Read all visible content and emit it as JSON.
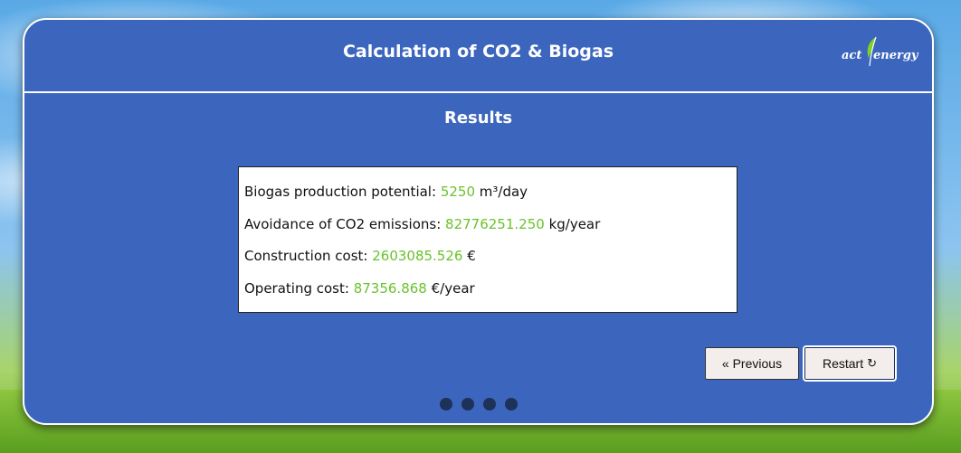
{
  "header": {
    "title": "Calculation of CO2 & Biogas",
    "logo": {
      "part1": "act",
      "part2": "energy",
      "leaf_color": "#7ed321"
    }
  },
  "results": {
    "heading": "Results",
    "rows": [
      {
        "label": "Biogas production potential:",
        "value": "5250",
        "unit": "m³/day"
      },
      {
        "label": "Avoidance of CO2 emissions:",
        "value": "82776251.250",
        "unit": "kg/year"
      },
      {
        "label": "Construction cost:",
        "value": "2603085.526",
        "unit": "€"
      },
      {
        "label": "Operating cost:",
        "value": "87356.868",
        "unit": "€/year"
      }
    ]
  },
  "buttons": {
    "previous": "« Previous",
    "restart": "Restart",
    "restart_icon": "refresh-icon"
  },
  "pagination": {
    "steps": 4
  },
  "colors": {
    "panel": "#3c66bd",
    "value": "#6ac22c",
    "dot": "#1e3159"
  }
}
